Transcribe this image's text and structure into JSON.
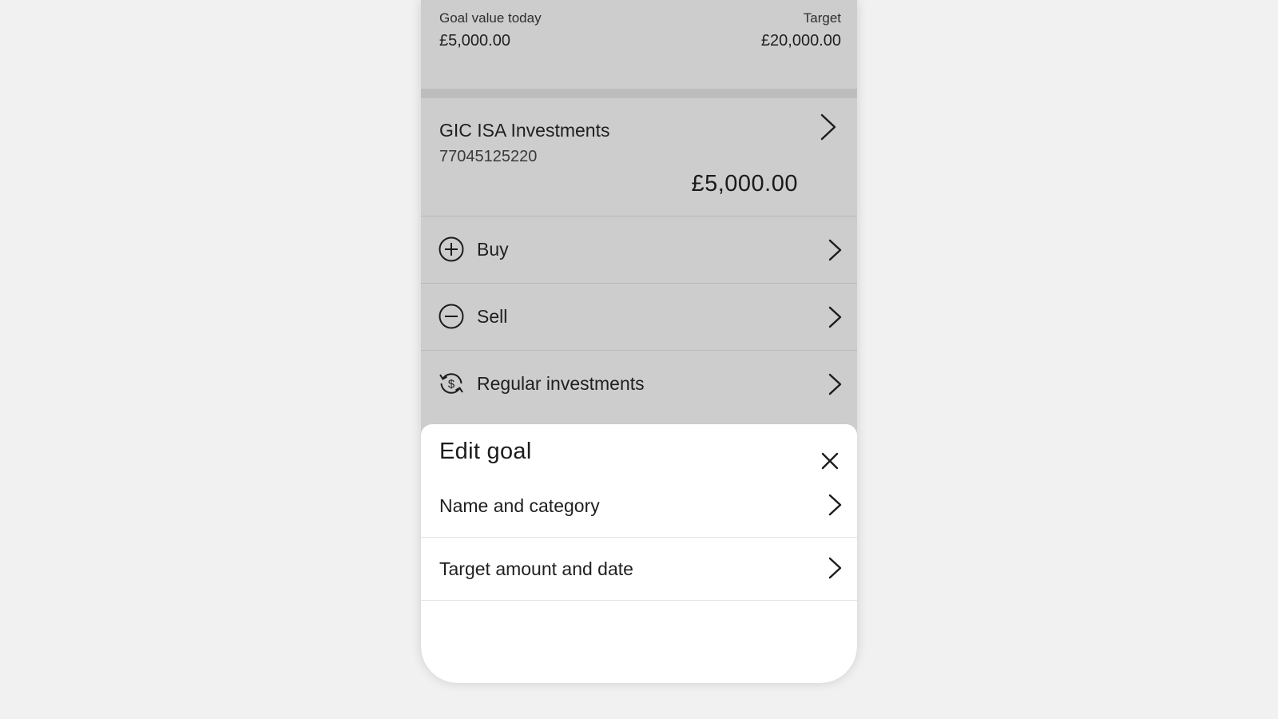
{
  "goal_summary": {
    "current_label": "Goal value today",
    "current_value": "£5,000.00",
    "target_label": "Target",
    "target_value": "£20,000.00"
  },
  "account": {
    "name": "GIC ISA Investments",
    "number": "77045125220",
    "balance": "£5,000.00",
    "icon": "chevron-right-icon"
  },
  "actions": [
    {
      "label": "Buy",
      "icon": "plus-circle-icon"
    },
    {
      "label": "Sell",
      "icon": "minus-circle-icon"
    },
    {
      "label": "Regular investments",
      "icon": "recurring-dollar-icon"
    }
  ],
  "sheet": {
    "title": "Edit goal",
    "close_icon": "close-icon",
    "items": [
      {
        "label": "Name and category"
      },
      {
        "label": "Target amount and date"
      }
    ]
  },
  "colors": {
    "page_background": "#f1f1f1",
    "dimmed_surface": "#cdcdcd",
    "sheet_background": "#ffffff",
    "text": "#1c1c1c"
  }
}
